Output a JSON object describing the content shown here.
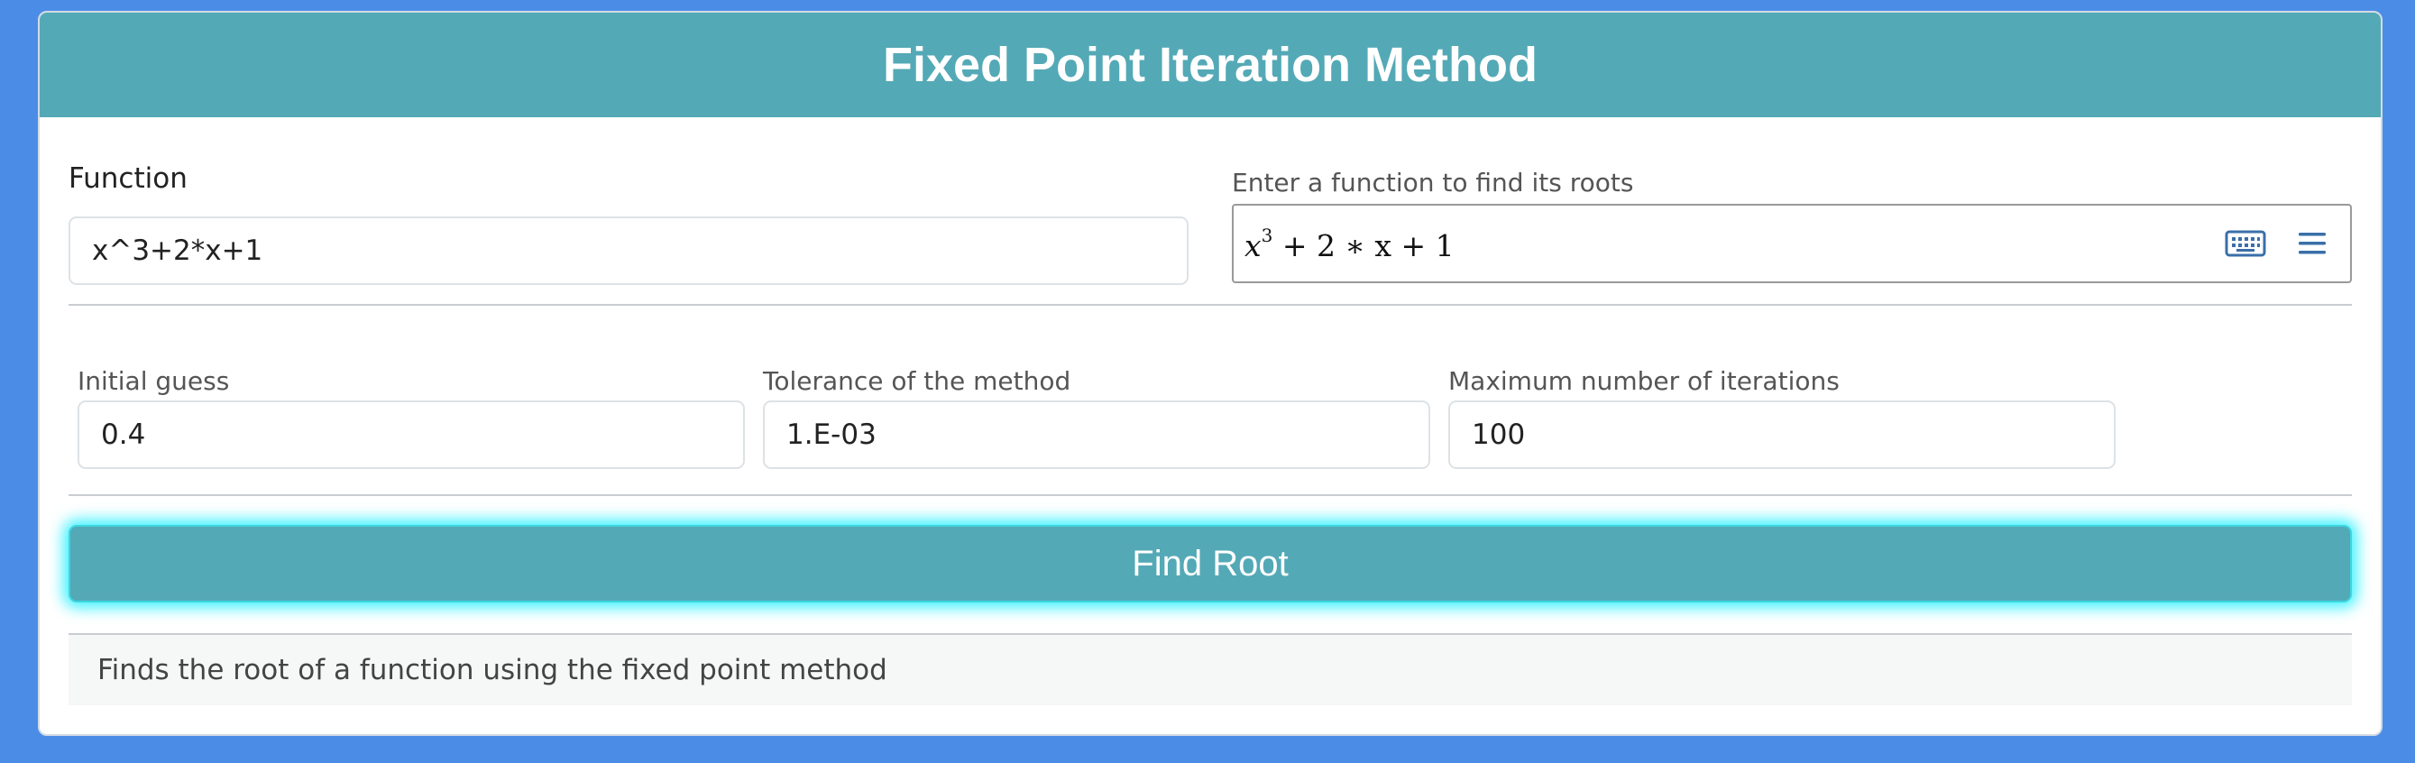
{
  "header": {
    "title": "Fixed Point Iteration Method"
  },
  "function_section": {
    "label": "Function",
    "value": "x^3+2*x+1",
    "hint": "Enter a function to find its roots",
    "math_display": {
      "base": "x",
      "exponent": "3",
      "rest": "+ 2 ∗ x + 1"
    },
    "keyboard_icon": "keyboard-icon",
    "menu_icon": "hamburger-menu-icon"
  },
  "params": {
    "initial_guess": {
      "label": "Initial guess",
      "value": "0.4"
    },
    "tolerance": {
      "label": "Tolerance of the method",
      "value": "1.E-03"
    },
    "max_iterations": {
      "label": "Maximum number of iterations",
      "value": "100"
    }
  },
  "action": {
    "label": "Find Root"
  },
  "footer": {
    "text": "Finds the root of a function using the fixed point method"
  },
  "colors": {
    "background": "#4b8de6",
    "header": "#54a9b6",
    "button": "#54a9b6",
    "button_glow": "#00eeff",
    "icon": "#3a6fa8"
  }
}
